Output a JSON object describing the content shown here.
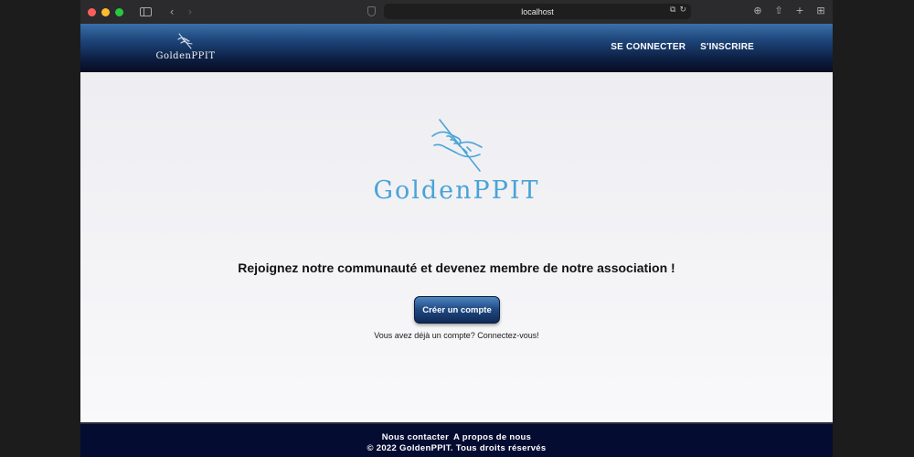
{
  "browser": {
    "url": "localhost",
    "icons": [
      "sidebar-icon",
      "back-icon",
      "forward-icon",
      "shield-icon",
      "translate-icon",
      "reload-icon",
      "download-icon",
      "share-icon",
      "new-tab-icon",
      "tab-overview-icon"
    ]
  },
  "header": {
    "logo_text": "GoldenPPIT",
    "nav": {
      "login": "SE CONNECTER",
      "signup": "S'INSCRIRE"
    }
  },
  "main": {
    "brand_name": "GoldenPPIT",
    "headline": "Rejoignez notre communauté et devenez membre de notre association !",
    "cta_label": "Créer un compte",
    "login_hint": "Vous avez déjà un compte? Connectez-vous!"
  },
  "footer": {
    "contact": "Nous contacter",
    "about": "A propos de nous",
    "copyright": "© 2022 GoldenPPIT. Tous droits réservés"
  },
  "colors": {
    "header_dark": "#0c1d40",
    "brand_blue": "#4aa3d6",
    "footer": "#050c32"
  }
}
